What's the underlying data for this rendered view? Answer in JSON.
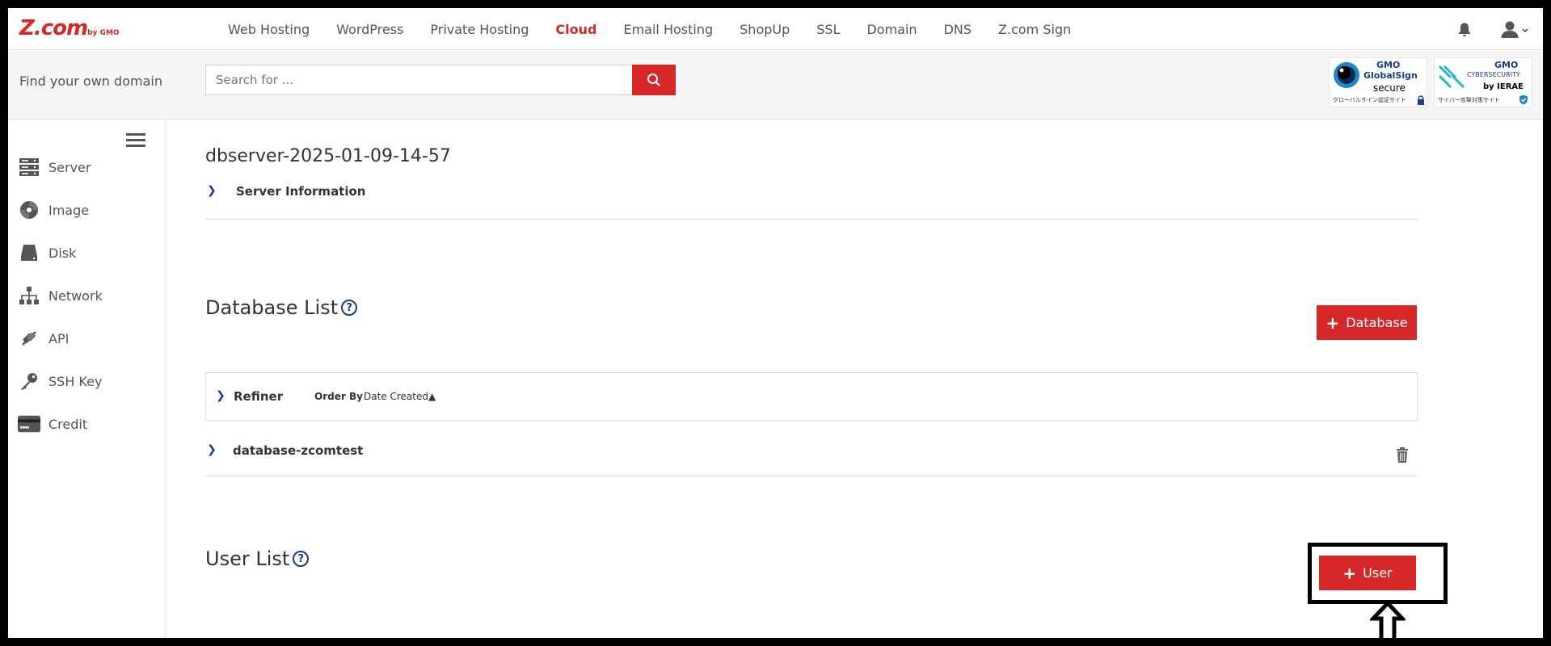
{
  "header": {
    "logo_main": "Z.com",
    "logo_sub": "by GMO",
    "nav": [
      {
        "label": "Web Hosting",
        "active": false
      },
      {
        "label": "WordPress",
        "active": false
      },
      {
        "label": "Private Hosting",
        "active": false
      },
      {
        "label": "Cloud",
        "active": true
      },
      {
        "label": "Email Hosting",
        "active": false
      },
      {
        "label": "ShopUp",
        "active": false
      },
      {
        "label": "SSL",
        "active": false
      },
      {
        "label": "Domain",
        "active": false
      },
      {
        "label": "DNS",
        "active": false
      },
      {
        "label": "Z.com Sign",
        "active": false
      }
    ],
    "icons": {
      "bell": "bell-icon",
      "user": "user-icon"
    }
  },
  "searchbar": {
    "label": "Find your own domain",
    "placeholder": "Search for ...",
    "badges": {
      "globalsign": {
        "brand": "GMO",
        "name": "GlobalSign",
        "sub": "secure",
        "caption": "グローバルサイン認証サイト"
      },
      "cyber": {
        "brand": "GMO",
        "name": "CYBERSECURITY",
        "sub": "by IERAE",
        "caption": "サイバー攻撃対策サイト"
      }
    }
  },
  "sidebar": {
    "items": [
      {
        "label": "Server",
        "icon": "server-icon"
      },
      {
        "label": "Image",
        "icon": "image-icon"
      },
      {
        "label": "Disk",
        "icon": "disk-icon"
      },
      {
        "label": "Network",
        "icon": "network-icon"
      },
      {
        "label": "API",
        "icon": "api-icon"
      },
      {
        "label": "SSH Key",
        "icon": "key-icon"
      },
      {
        "label": "Credit",
        "icon": "credit-card-icon"
      }
    ]
  },
  "main": {
    "server_name": "dbserver-2025-01-09-14-57",
    "server_info_label": "Server Information",
    "database_list_title": "Database List",
    "add_database_label": "Database",
    "refiner_label": "Refiner",
    "order_by_label": "Order By",
    "order_by_value": "Date Created▲",
    "databases": [
      {
        "name": "database-zcomtest"
      }
    ],
    "user_list_title": "User List",
    "add_user_label": "User",
    "help_glyph": "?"
  },
  "colors": {
    "brand_red": "#d62828",
    "accent_blue": "#1a3b8e"
  }
}
